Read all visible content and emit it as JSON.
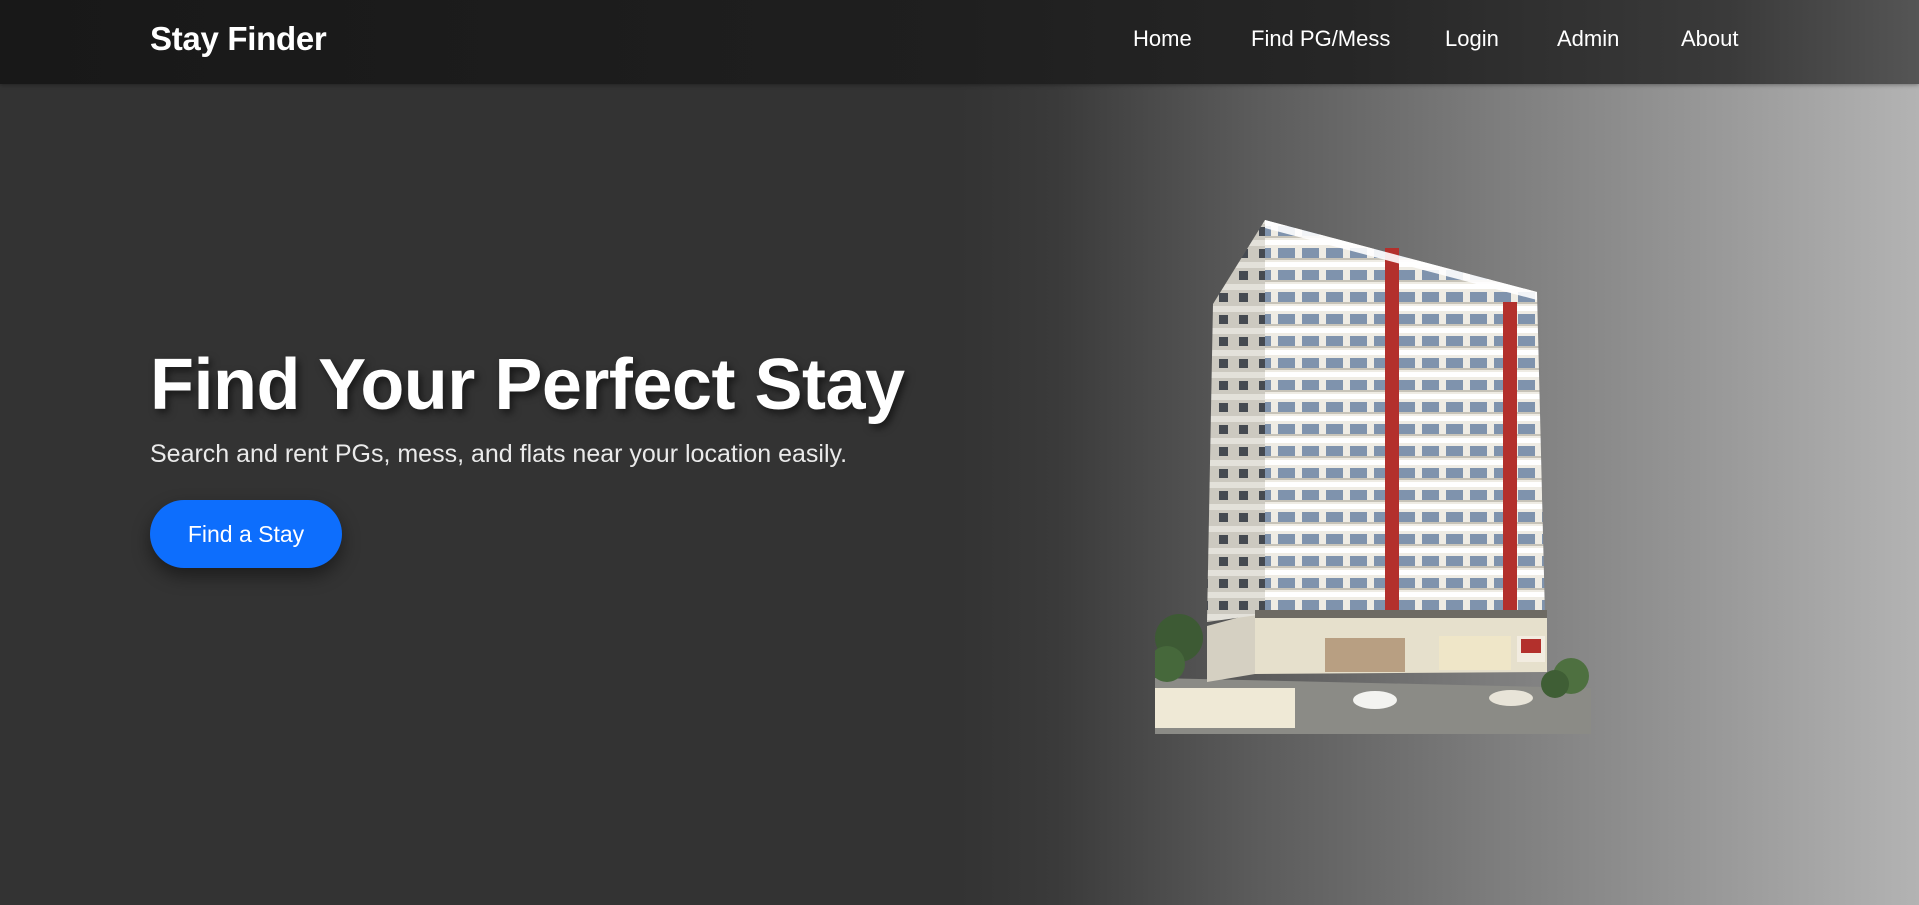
{
  "navbar": {
    "brand": "Stay Finder",
    "links": [
      "Home",
      "Find PG/Mess",
      "Login",
      "Admin",
      "About"
    ]
  },
  "hero": {
    "title": "Find Your Perfect Stay",
    "subtitle": "Search and rent PGs, mess, and flats near your location easily.",
    "cta_label": "Find a Stay",
    "image": "apartment-building-image"
  },
  "colors": {
    "primary": "#0d6efd",
    "navbar": "#1c1c1c",
    "background": "#333333",
    "building_accent": "#b3302c"
  }
}
